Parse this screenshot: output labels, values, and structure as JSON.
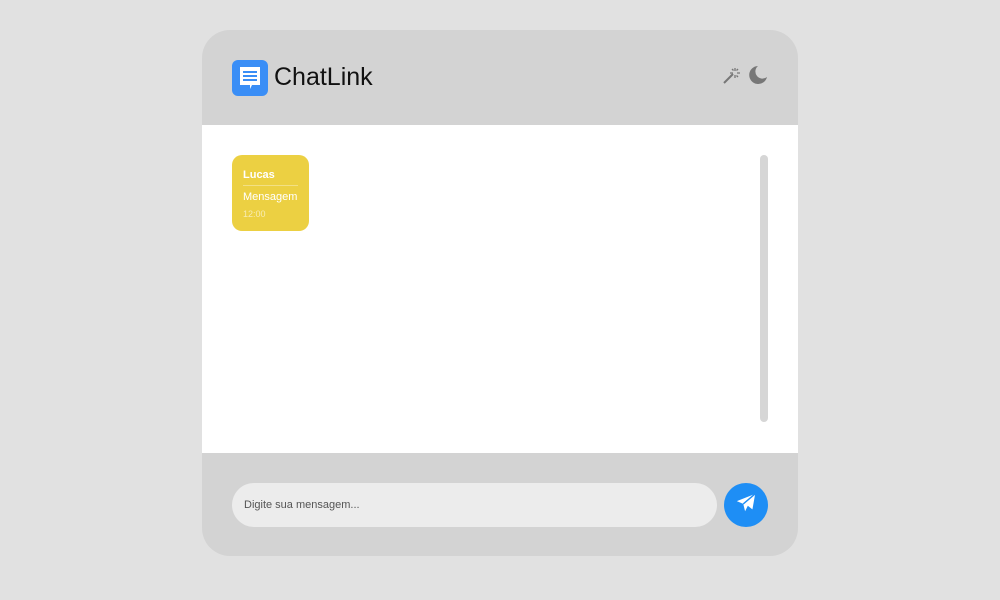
{
  "header": {
    "title": "ChatLink",
    "icons": [
      "chat-logo-icon",
      "magic-wand-icon",
      "moon-icon"
    ]
  },
  "messages": [
    {
      "sender": "Lucas",
      "text": "Mensagem",
      "time": "12:00"
    }
  ],
  "composer": {
    "placeholder": "Digite sua mensagem...",
    "value": ""
  },
  "colors": {
    "accent": "#1e8ef5",
    "message_bubble": "#ecd042",
    "header": "#d3d3d3"
  }
}
